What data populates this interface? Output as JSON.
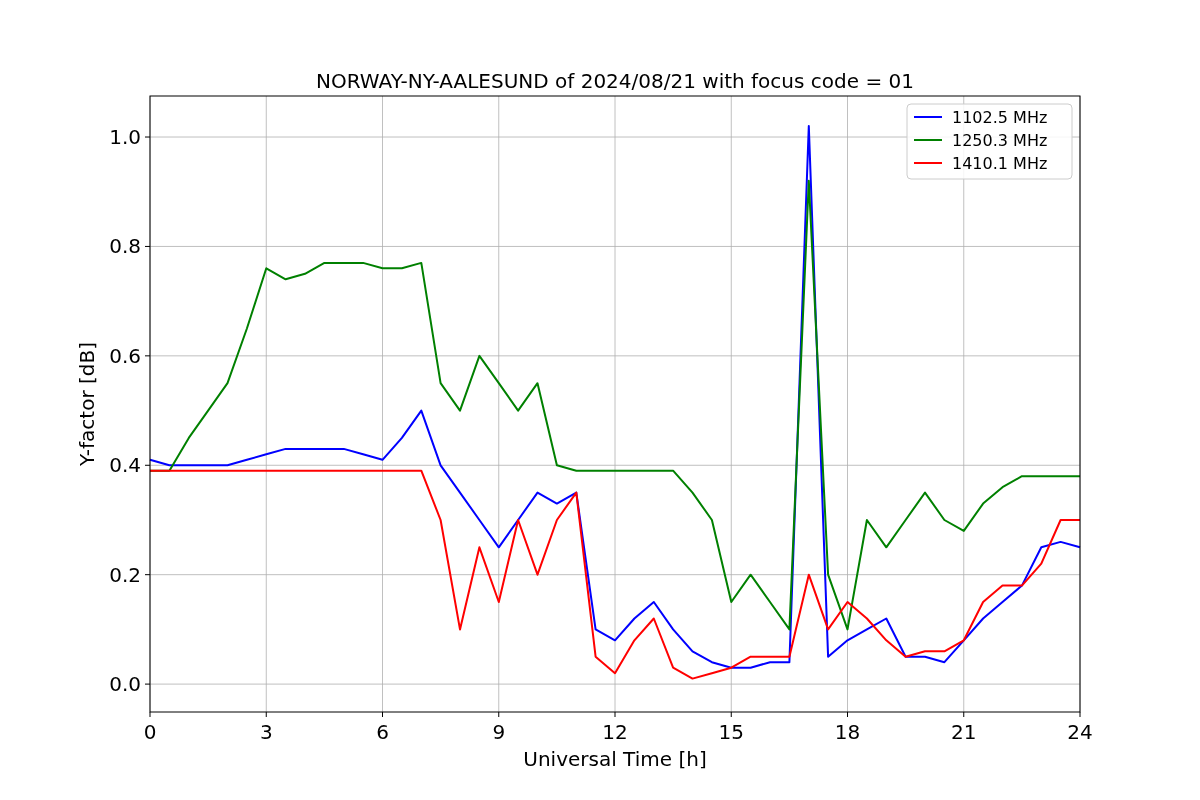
{
  "chart_data": {
    "type": "line",
    "title": "NORWAY-NY-AALESUND of 2024/08/21 with focus code = 01",
    "xlabel": "Universal Time [h]",
    "ylabel": "Y-factor [dB]",
    "x": [
      0,
      0.5,
      1,
      1.5,
      2,
      2.5,
      3,
      3.5,
      4,
      4.5,
      5,
      5.5,
      6,
      6.5,
      7,
      7.5,
      8,
      8.5,
      9,
      9.5,
      10,
      10.5,
      11,
      11.5,
      12,
      12.5,
      13,
      13.5,
      14,
      14.5,
      15,
      15.5,
      16,
      16.5,
      17,
      17.5,
      18,
      18.5,
      19,
      19.5,
      20,
      20.5,
      21,
      21.5,
      22,
      22.5,
      23,
      23.5,
      24
    ],
    "series": [
      {
        "name": "1102.5 MHz",
        "color": "#0000ff",
        "values": [
          0.41,
          0.4,
          0.4,
          0.4,
          0.4,
          0.41,
          0.42,
          0.43,
          0.43,
          0.43,
          0.43,
          0.42,
          0.41,
          0.45,
          0.5,
          0.4,
          0.35,
          0.3,
          0.25,
          0.3,
          0.35,
          0.33,
          0.35,
          0.1,
          0.08,
          0.12,
          0.15,
          0.1,
          0.06,
          0.04,
          0.03,
          0.03,
          0.04,
          0.04,
          1.02,
          0.05,
          0.08,
          0.1,
          0.12,
          0.05,
          0.05,
          0.04,
          0.08,
          0.12,
          0.15,
          0.18,
          0.25,
          0.26,
          0.25
        ]
      },
      {
        "name": "1250.3 MHz",
        "color": "#008000",
        "values": [
          0.39,
          0.39,
          0.45,
          0.5,
          0.55,
          0.65,
          0.76,
          0.74,
          0.75,
          0.77,
          0.77,
          0.77,
          0.76,
          0.76,
          0.77,
          0.55,
          0.5,
          0.6,
          0.55,
          0.5,
          0.55,
          0.4,
          0.39,
          0.39,
          0.39,
          0.39,
          0.39,
          0.39,
          0.35,
          0.3,
          0.15,
          0.2,
          0.15,
          0.1,
          0.92,
          0.2,
          0.1,
          0.3,
          0.25,
          0.3,
          0.35,
          0.3,
          0.28,
          0.33,
          0.36,
          0.38,
          0.38,
          0.38,
          0.38
        ]
      },
      {
        "name": "1410.1 MHz",
        "color": "#ff0000",
        "values": [
          0.39,
          0.39,
          0.39,
          0.39,
          0.39,
          0.39,
          0.39,
          0.39,
          0.39,
          0.39,
          0.39,
          0.39,
          0.39,
          0.39,
          0.39,
          0.3,
          0.1,
          0.25,
          0.15,
          0.3,
          0.2,
          0.3,
          0.35,
          0.05,
          0.02,
          0.08,
          0.12,
          0.03,
          0.01,
          0.02,
          0.03,
          0.05,
          0.05,
          0.05,
          0.2,
          0.1,
          0.15,
          0.12,
          0.08,
          0.05,
          0.06,
          0.06,
          0.08,
          0.15,
          0.18,
          0.18,
          0.22,
          0.3,
          0.3
        ]
      }
    ],
    "grid": true,
    "legend": true,
    "xlim": [
      0,
      24
    ],
    "ylim": [
      -0.051,
      1.075
    ],
    "xticks": [
      0,
      3,
      6,
      9,
      12,
      15,
      18,
      21,
      24
    ],
    "yticks": [
      {
        "value": 0,
        "label": "0.0"
      },
      {
        "value": 0.2,
        "label": "0.2"
      },
      {
        "value": 0.4,
        "label": "0.4"
      },
      {
        "value": 0.6,
        "label": "0.6"
      },
      {
        "value": 0.8,
        "label": "0.8"
      },
      {
        "value": 1,
        "label": "1.0"
      }
    ]
  }
}
